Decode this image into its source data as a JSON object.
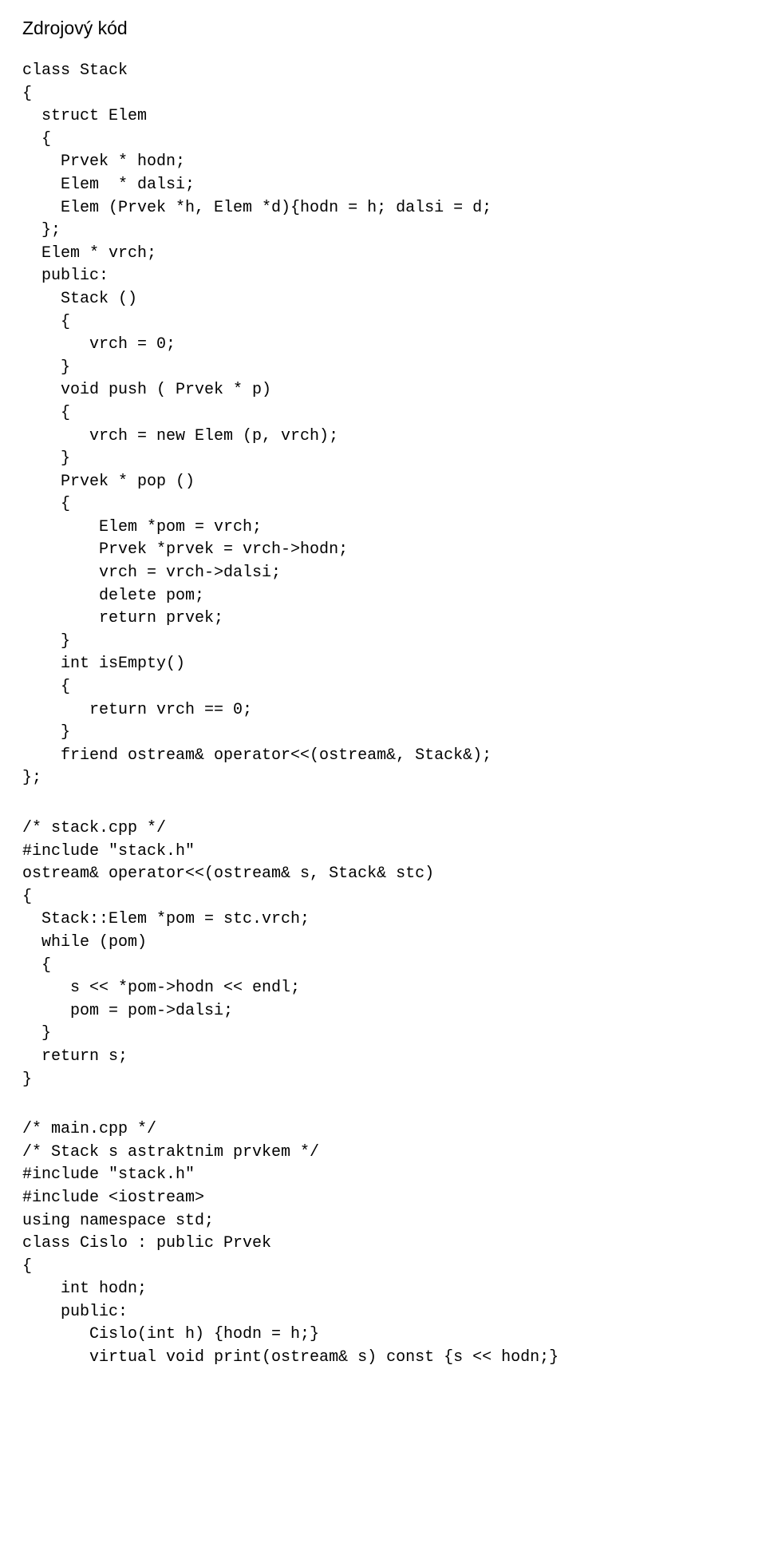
{
  "heading": "Zdrojový kód",
  "code_block_1": "class Stack\n{\n  struct Elem\n  {\n    Prvek * hodn;\n    Elem  * dalsi;\n    Elem (Prvek *h, Elem *d){hodn = h; dalsi = d;\n  };\n  Elem * vrch;\n  public:\n    Stack ()\n    {\n       vrch = 0;\n    }\n    void push ( Prvek * p)\n    {\n       vrch = new Elem (p, vrch);\n    }\n    Prvek * pop ()\n    {\n        Elem *pom = vrch;\n        Prvek *prvek = vrch->hodn;\n        vrch = vrch->dalsi;\n        delete pom;\n        return prvek;\n    }\n    int isEmpty()\n    {\n       return vrch == 0;\n    }\n    friend ostream& operator<<(ostream&, Stack&);\n};",
  "code_block_2": "/* stack.cpp */\n#include \"stack.h\"\nostream& operator<<(ostream& s, Stack& stc)\n{\n  Stack::Elem *pom = stc.vrch;\n  while (pom)\n  {\n     s << *pom->hodn << endl;\n     pom = pom->dalsi;\n  }\n  return s;\n}",
  "code_block_3": "/* main.cpp */\n/* Stack s astraktnim prvkem */\n#include \"stack.h\"\n#include <iostream>\nusing namespace std;\nclass Cislo : public Prvek\n{\n    int hodn;\n    public:\n       Cislo(int h) {hodn = h;}\n       virtual void print(ostream& s) const {s << hodn;}"
}
